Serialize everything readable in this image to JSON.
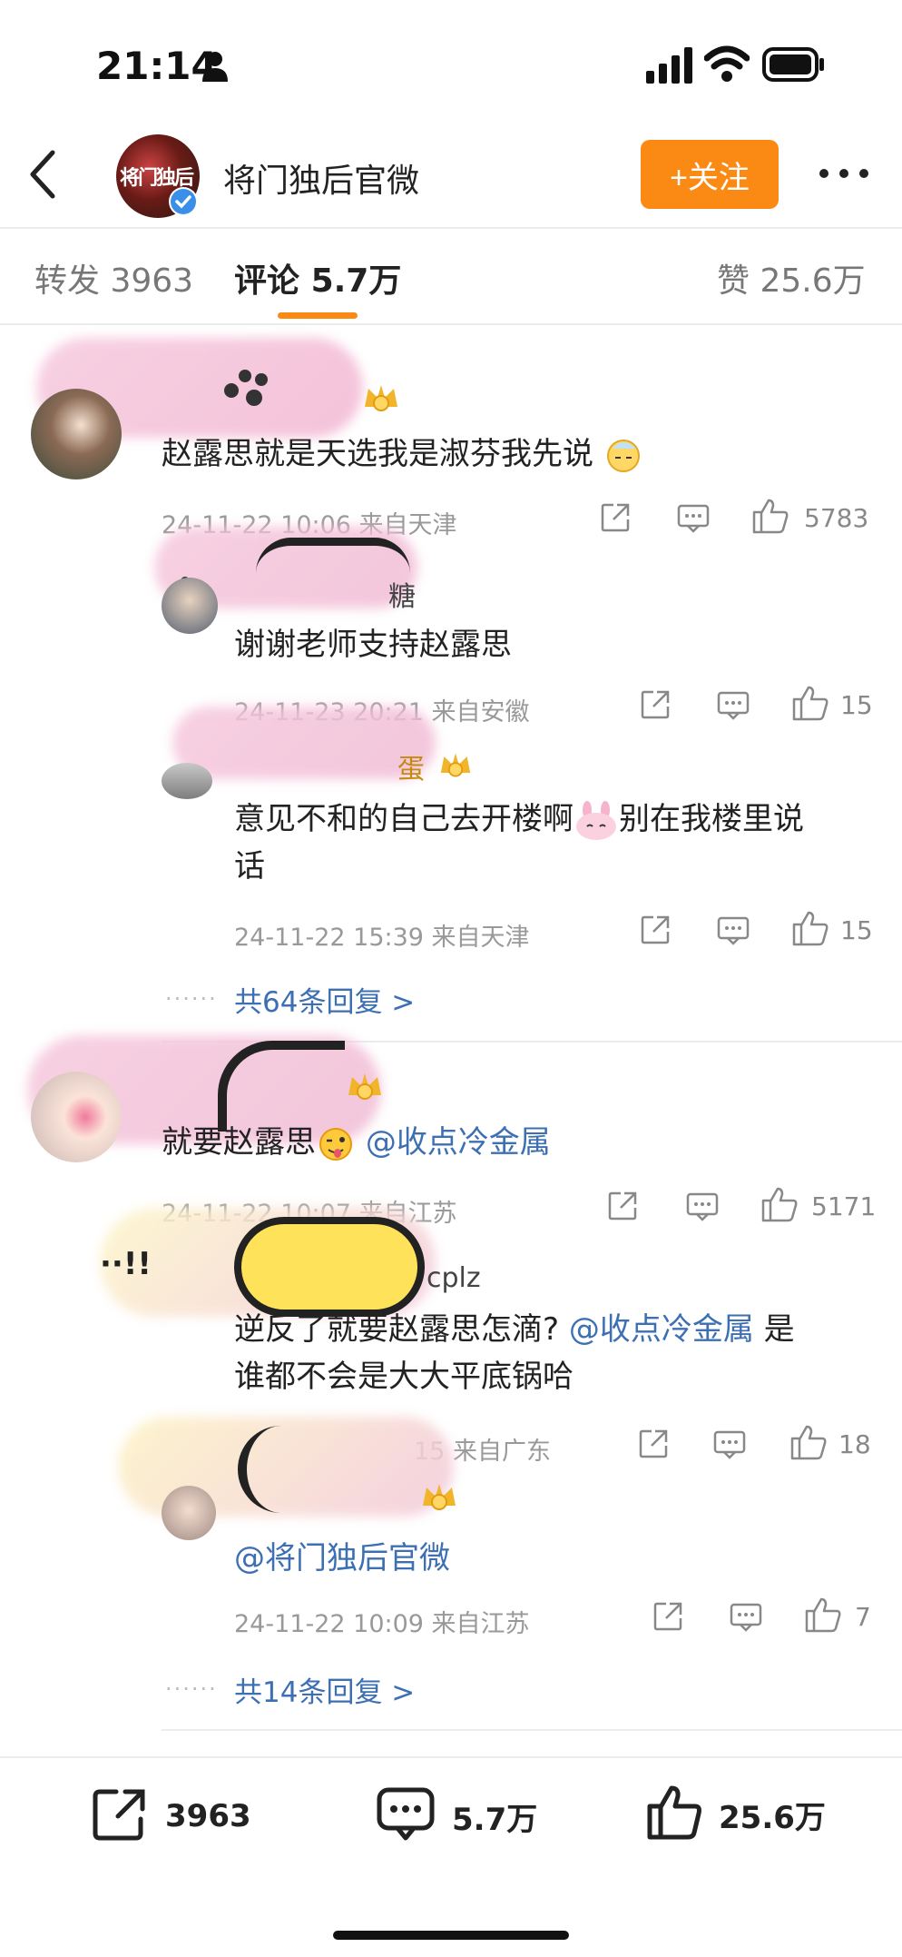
{
  "status_bar": {
    "time": "21:14",
    "icons": [
      "person-icon",
      "signal-icon",
      "wifi-icon",
      "battery-icon"
    ]
  },
  "header": {
    "account_name": "将门独后官微",
    "avatar_text": "将门独后",
    "follow_label": "+关注"
  },
  "tabs": [
    {
      "label": "转发",
      "count": "3963"
    },
    {
      "label": "评论",
      "count": "5.7万",
      "active": true
    },
    {
      "label": "赞",
      "count": "25.6万"
    }
  ],
  "comments": [
    {
      "text": "赵露思就是天选我是淑芬我先说",
      "time": "24-11-22 10:06",
      "location": "来自天津",
      "likes": "5783",
      "replies": [
        {
          "name_partial": "糖",
          "text": "谢谢老师支持赵露思",
          "time": "24-11-23 20:21",
          "location": "来自安徽",
          "likes": "15"
        },
        {
          "name_partial": "蛋",
          "text_line1": "意见不和的自己去开楼啊",
          "text_line2": "别在我楼里说",
          "text_line3": "话",
          "time": "24-11-22 15:39",
          "location": "来自天津",
          "likes": "15"
        }
      ],
      "more_replies": "共64条回复 >"
    },
    {
      "text": "就要赵露思",
      "mention": "@收点冷金属",
      "time": "24-11-22 10:07",
      "location": "来自江苏",
      "likes": "5171",
      "replies": [
        {
          "name_partial": "cplz",
          "text_prefix": "逆反了就要赵露思怎滴?",
          "mention": "@收点冷金属",
          "text_suffix": "是",
          "text_line2": "谁都不会是大大平底锅哈",
          "time_partial": "15",
          "location": "来自广东",
          "likes": "18"
        },
        {
          "mention": "@将门独后官微",
          "time": "24-11-22 10:09",
          "location": "来自江苏",
          "likes": "7"
        }
      ],
      "more_replies": "共14条回复 >"
    }
  ],
  "bottom_bar": {
    "repost": "3963",
    "comment": "5.7万",
    "like": "25.6万"
  },
  "colors": {
    "accent": "#fb8a14",
    "link": "#3d6fb3"
  }
}
